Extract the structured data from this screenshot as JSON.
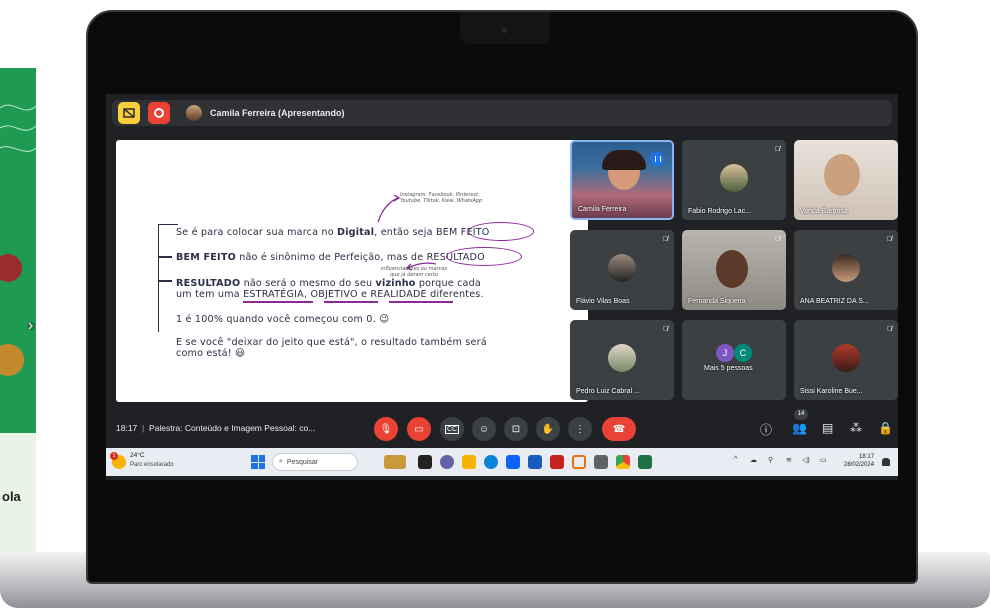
{
  "meeting": {
    "presenter_label": "Camila Ferreira (Apresentando)",
    "time": "18:17",
    "title": "Palestra: Conteúdo e Imagem Pessoal: co..."
  },
  "slide": {
    "line1_pre": "Se é para colocar sua marca no",
    "line1_bold": "Digital",
    "line1_mid": ", então seja",
    "line1_circled": "BEM FEITO",
    "note1": "Instagram, Facebook, Pinterest, Youtube, Tiktok, Kwai, WhatsApp",
    "line2_bold": "BEM FEITO",
    "line2_mid": "não é sinônimo de Perfeição, mas de",
    "line2_circled": "RESULTADO",
    "note2": "influenciadores ou marcas que já deram certo",
    "line3_bold": "RESULTADO",
    "line3_mid": "não será o mesmo do seu",
    "line3_bold2": "vizinho",
    "line3_end": "porque cada",
    "line4_pre": "um tem uma",
    "line4_w1": "ESTRATÉGIA",
    "line4_w2": "OBJETIVO",
    "line4_w3": "REALIDADE",
    "line4_end": "diferentes.",
    "line5": "1 é 100% quando você começou com 0. 😉",
    "line6": "E se você \"deixar do jeito que está\", o resultado também será",
    "line7": "como está! 😃"
  },
  "participants": [
    {
      "name": "Camila Ferreira"
    },
    {
      "name": "Fabio Rodrigo Lac..."
    },
    {
      "name": "Vanda Barbosa"
    },
    {
      "name": "Flávio Vilas Boas"
    },
    {
      "name": "Fernanda Siqueira"
    },
    {
      "name": "ANA BEATRIZ DA S..."
    },
    {
      "name": "Pedro Luiz Cabral ..."
    },
    {
      "name": "Mais 5 pessoas",
      "initials": [
        "J",
        "C"
      ]
    },
    {
      "name": "Sissi Karoline Bue..."
    }
  ],
  "people_count": "14",
  "taskbar": {
    "temperature": "24°C",
    "weather": "Parc ensolarado",
    "weather_badge": "1",
    "search_placeholder": "Pesquisar",
    "clock_time": "18:17",
    "clock_date": "28/02/2024"
  },
  "side_panel": {
    "text": "ola"
  },
  "colors": {
    "meet_bg": "#202124",
    "hangup": "#ea4335",
    "highlight": "#8d2a9b",
    "side_green": "#1f9a52"
  }
}
